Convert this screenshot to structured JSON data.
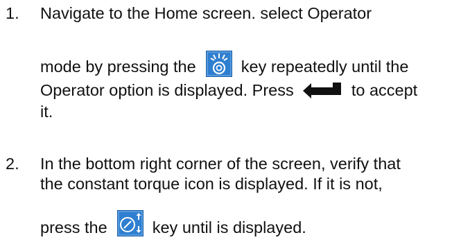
{
  "steps": [
    {
      "number": "1.",
      "line1": "Navigate to the Home screen. select Operator",
      "line2_before": "mode by pressing the",
      "line2_after": "key repeatedly until the",
      "line3_before": "Operator option is displayed. Press",
      "line3_after": "to accept",
      "line4": "it.",
      "icons": [
        "operator-mode-key-icon",
        "enter-key-icon"
      ]
    },
    {
      "number": "2.",
      "line1": "In the bottom right corner of the screen, verify that",
      "line2": "the constant torque icon is displayed. If it is not,",
      "line3_before": "press the",
      "line3_after": "key until is displayed.",
      "icons": [
        "constant-torque-key-icon"
      ]
    }
  ],
  "colors": {
    "text": "#111111",
    "key_blue": "#2f7fd0",
    "key_border": "#1b5fa8"
  }
}
